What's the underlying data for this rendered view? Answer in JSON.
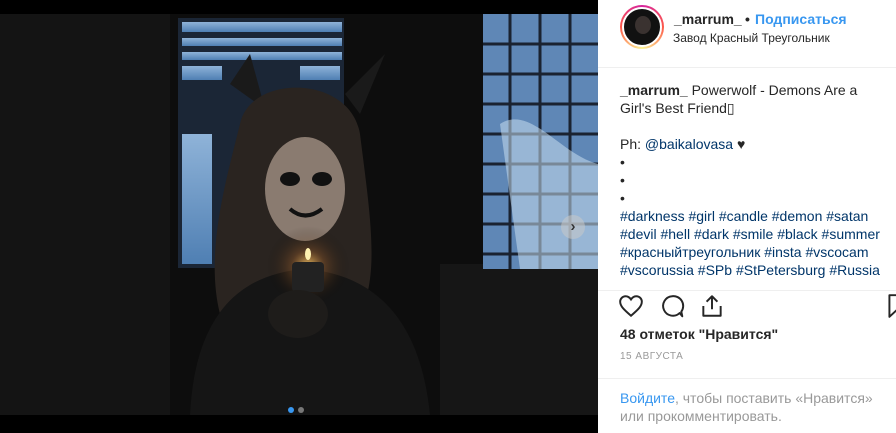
{
  "header": {
    "username": "_marrum_",
    "separator": "•",
    "follow_label": "Подписаться",
    "location": "Завод Красный Треугольник"
  },
  "caption": {
    "username": "_marrum_",
    "text": "Powerwolf - Demons Are a Girl's Best Friend▯",
    "credit_prefix": "Ph:",
    "credit_handle": "@baikalovasa",
    "credit_suffix": "♥",
    "bullets": [
      "•",
      "•",
      "•"
    ],
    "hashtags": "#darkness #girl #candle #demon #satan #devil #hell #dark #smile #black #summer #красныйтреугольник #insta #vscocam #vscorussia #SPb #StPetersburg #Russia"
  },
  "icons": {
    "like": "heart-icon",
    "comment": "comment-icon",
    "share": "share-icon",
    "save": "bookmark-icon",
    "next": "chevron-right-icon"
  },
  "likes_text": "48 отметок \"Нравится\"",
  "date_text": "15 АВГУСТА",
  "login": {
    "link": "Войдите",
    "rest": ", чтобы поставить «Нравится» или прокомментировать."
  },
  "carousel": {
    "next_glyph": "›",
    "slide_count": 2,
    "active_slide": 1
  },
  "colors": {
    "accent": "#3897f0",
    "hashtag": "#003569",
    "muted": "#999999",
    "text": "#262626"
  }
}
